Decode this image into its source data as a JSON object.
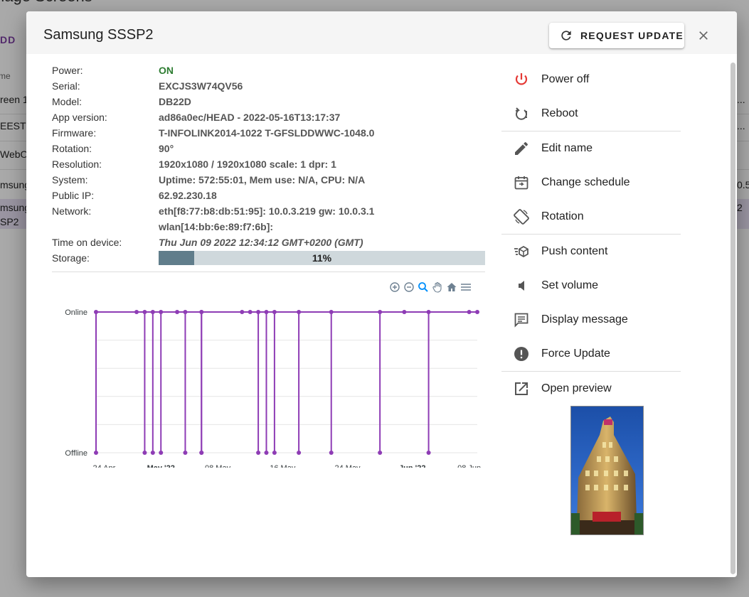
{
  "background": {
    "title": "nage Screens",
    "add_label": "DD",
    "column_header": "me",
    "rows": [
      {
        "text": "reen 1",
        "right": "..."
      },
      {
        "text": "EEST",
        "right": "..."
      },
      {
        "text": "WebO",
        "right": ""
      },
      {
        "text": "msung",
        "right": "0.5"
      },
      {
        "text": "msung",
        "right": "2"
      },
      {
        "text": "SP2",
        "right": ""
      }
    ]
  },
  "dialog": {
    "title": "Samsung SSSP2",
    "request_update_label": "REQUEST UPDATE",
    "close_icon": "close-icon"
  },
  "info": [
    {
      "key": "Power:",
      "value": "ON",
      "status": "on"
    },
    {
      "key": "Serial:",
      "value": "EXCJS3W74QV56"
    },
    {
      "key": "Model:",
      "value": "DB22D"
    },
    {
      "key": "App version:",
      "value": "ad86a0ec/HEAD - 2022-05-16T13:17:37"
    },
    {
      "key": "Firmware:",
      "value": "T-INFOLINK2014-1022 T-GFSLDDWWC-1048.0"
    },
    {
      "key": "Rotation:",
      "value": "90°"
    },
    {
      "key": "Resolution:",
      "value": "1920x1080 / 1920x1080 scale: 1 dpr: 1"
    },
    {
      "key": "System:",
      "value": "Uptime: 572:55:01, Mem use: N/A, CPU: N/A"
    },
    {
      "key": "Public IP:",
      "value": "62.92.230.18"
    },
    {
      "key": "Network:",
      "value": "eth[f8:77:b8:db:51:95]: 10.0.3.219 gw: 10.0.3.1"
    },
    {
      "key": "",
      "value": "wlan[14:bb:6e:89:f7:6b]:"
    },
    {
      "key": "Time on device:",
      "value": "Thu Jun 09 2022 12:34:12 GMT+0200 (GMT)",
      "status": "time"
    }
  ],
  "storage": {
    "label": "Storage:",
    "percent": 11,
    "text": "11%"
  },
  "chart_data": {
    "type": "line",
    "y_categories": [
      "Offline",
      "Online"
    ],
    "x_ticks": [
      {
        "date": "2022-04-24",
        "label": "24 Apr",
        "bold": false
      },
      {
        "date": "2022-05-01",
        "label": "May '22",
        "bold": true
      },
      {
        "date": "2022-05-08",
        "label": "08 May",
        "bold": false
      },
      {
        "date": "2022-05-16",
        "label": "16 May",
        "bold": false
      },
      {
        "date": "2022-05-24",
        "label": "24 May",
        "bold": false
      },
      {
        "date": "2022-06-01",
        "label": "Jun '22",
        "bold": true
      },
      {
        "date": "2022-06-08",
        "label": "08 Jun",
        "bold": false
      }
    ],
    "xlim": [
      "2022-04-23",
      "2022-06-09"
    ],
    "dropouts": [
      "2022-04-23",
      "2022-04-29",
      "2022-04-30",
      "2022-05-01",
      "2022-05-04",
      "2022-05-06",
      "2022-05-06",
      "2022-05-13",
      "2022-05-14",
      "2022-05-15",
      "2022-05-18",
      "2022-05-22",
      "2022-05-28",
      "2022-06-03"
    ],
    "online_points": [
      "2022-04-23",
      "2022-04-28",
      "2022-04-29",
      "2022-04-30",
      "2022-05-01",
      "2022-05-03",
      "2022-05-04",
      "2022-05-06",
      "2022-05-06",
      "2022-05-11",
      "2022-05-12",
      "2022-05-13",
      "2022-05-14",
      "2022-05-15",
      "2022-05-18",
      "2022-05-22",
      "2022-05-28",
      "2022-05-31",
      "2022-06-03",
      "2022-06-08",
      "2022-06-09"
    ],
    "line_color": "#8e3cb5",
    "grid": true
  },
  "chart_tools": [
    "zoom-in-icon",
    "zoom-out-icon",
    "selection-zoom-icon",
    "pan-hand-icon",
    "reset-home-icon",
    "menu-icon"
  ],
  "menu": {
    "groups": [
      [
        {
          "label": "Power off",
          "icon": "power-icon",
          "color": "#e53935"
        },
        {
          "label": "Reboot",
          "icon": "reboot-icon"
        }
      ],
      [
        {
          "label": "Edit name",
          "icon": "pencil-icon"
        },
        {
          "label": "Change schedule",
          "icon": "calendar-icon"
        },
        {
          "label": "Rotation",
          "icon": "screen-rotation-icon"
        }
      ],
      [
        {
          "label": "Push content",
          "icon": "push-content-icon"
        },
        {
          "label": "Set volume",
          "icon": "volume-icon"
        },
        {
          "label": "Display message",
          "icon": "message-icon"
        },
        {
          "label": "Force Update",
          "icon": "alert-circle-icon"
        }
      ],
      [
        {
          "label": "Open preview",
          "icon": "open-external-icon"
        }
      ]
    ]
  },
  "preview": {
    "icon": "screen-preview-image"
  }
}
